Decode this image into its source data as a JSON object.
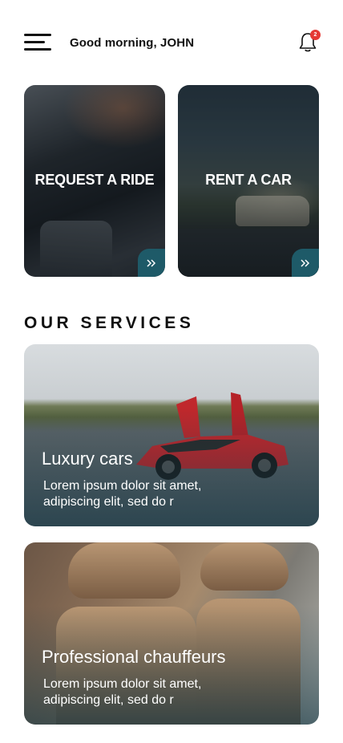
{
  "header": {
    "greeting": "Good morning, JOHN",
    "notification_count": "2"
  },
  "quick_actions": [
    {
      "label": "REQUEST A RIDE"
    },
    {
      "label": "RENT A CAR"
    }
  ],
  "services": {
    "title": "OUR SERVICES",
    "items": [
      {
        "title": "Luxury cars",
        "description": "Lorem ipsum dolor sit amet, adipiscing elit, sed do r"
      },
      {
        "title": "Professional chauffeurs",
        "description": "Lorem ipsum dolor sit amet, adipiscing elit, sed do r"
      }
    ]
  },
  "colors": {
    "accent": "#1e5a68",
    "badge": "#e53935"
  },
  "icons": [
    "menu-icon",
    "bell-icon",
    "chevron-right-icon"
  ]
}
